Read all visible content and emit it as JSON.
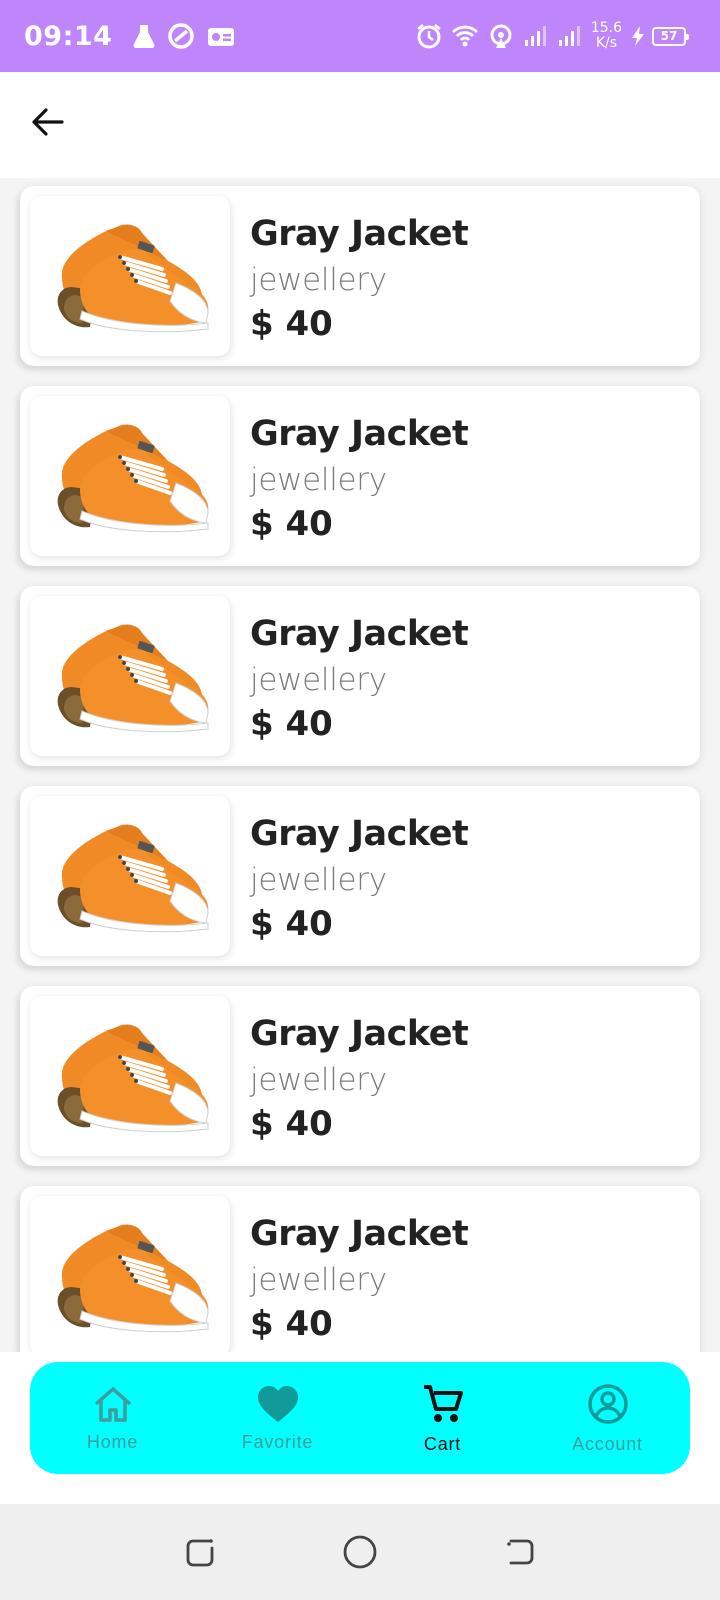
{
  "status_bar": {
    "time": "09:14",
    "net_speed_value": "15.6",
    "net_speed_unit": "K/s",
    "battery_level": "57",
    "colors": {
      "background": "#bf86fb",
      "foreground": "#ffffff"
    }
  },
  "app_bar": {
    "back_icon": "arrow-left-icon"
  },
  "products": [
    {
      "title": "Gray Jacket",
      "category": "jewellery",
      "price": "$ 40",
      "image": "orange-sneaker"
    },
    {
      "title": "Gray Jacket",
      "category": "jewellery",
      "price": "$ 40",
      "image": "orange-sneaker"
    },
    {
      "title": "Gray Jacket",
      "category": "jewellery",
      "price": "$ 40",
      "image": "orange-sneaker"
    },
    {
      "title": "Gray Jacket",
      "category": "jewellery",
      "price": "$ 40",
      "image": "orange-sneaker"
    },
    {
      "title": "Gray Jacket",
      "category": "jewellery",
      "price": "$ 40",
      "image": "orange-sneaker"
    },
    {
      "title": "Gray Jacket",
      "category": "jewellery",
      "price": "$ 40",
      "image": "orange-sneaker"
    }
  ],
  "bottom_nav": {
    "items": [
      {
        "label": "Home",
        "icon": "home-icon",
        "active": false
      },
      {
        "label": "Favorite",
        "icon": "heart-icon",
        "active": false
      },
      {
        "label": "Cart",
        "icon": "cart-icon",
        "active": true
      },
      {
        "label": "Account",
        "icon": "account-icon",
        "active": false
      }
    ],
    "colors": {
      "background": "#00ffff",
      "inactive": "#3d9d9d",
      "active": "#111111"
    }
  },
  "system_nav": {
    "buttons": [
      "recents-icon",
      "home-circle-icon",
      "back-gesture-icon"
    ]
  }
}
